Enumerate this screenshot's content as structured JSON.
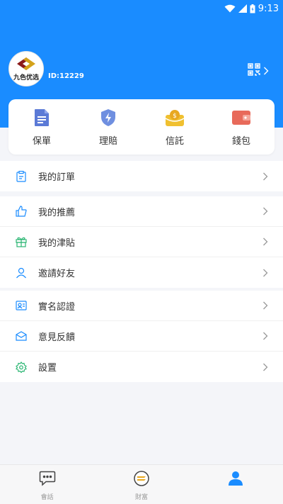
{
  "status_bar": {
    "time": "9:13"
  },
  "profile": {
    "user_id": "ID:12229",
    "avatar_logo_text": "九色优选"
  },
  "quick_actions": [
    {
      "label": "保單",
      "icon": "document-icon"
    },
    {
      "label": "理賠",
      "icon": "shield-icon"
    },
    {
      "label": "信託",
      "icon": "money-pouch-icon"
    },
    {
      "label": "錢包",
      "icon": "wallet-icon"
    }
  ],
  "menu": {
    "group1": [
      {
        "label": "我的訂單",
        "icon": "clipboard-icon"
      }
    ],
    "group2": [
      {
        "label": "我的推薦",
        "icon": "thumbs-up-icon"
      },
      {
        "label": "我的津貼",
        "icon": "gift-icon"
      },
      {
        "label": "邀請好友",
        "icon": "person-icon"
      }
    ],
    "group3": [
      {
        "label": "實名認證",
        "icon": "id-card-icon"
      },
      {
        "label": "意見反饋",
        "icon": "mail-icon"
      },
      {
        "label": "設置",
        "icon": "gear-icon"
      }
    ]
  },
  "tabbar": [
    {
      "label": "會話",
      "icon": "chat-icon"
    },
    {
      "label": "財富",
      "icon": "coin-icon"
    },
    {
      "label": "",
      "icon": "profile-icon",
      "active": true
    }
  ],
  "colors": {
    "primary": "#1a8cff",
    "background": "#f4f5f9",
    "tab_inactive": "#999999",
    "tab_active": "#1a8cff"
  }
}
